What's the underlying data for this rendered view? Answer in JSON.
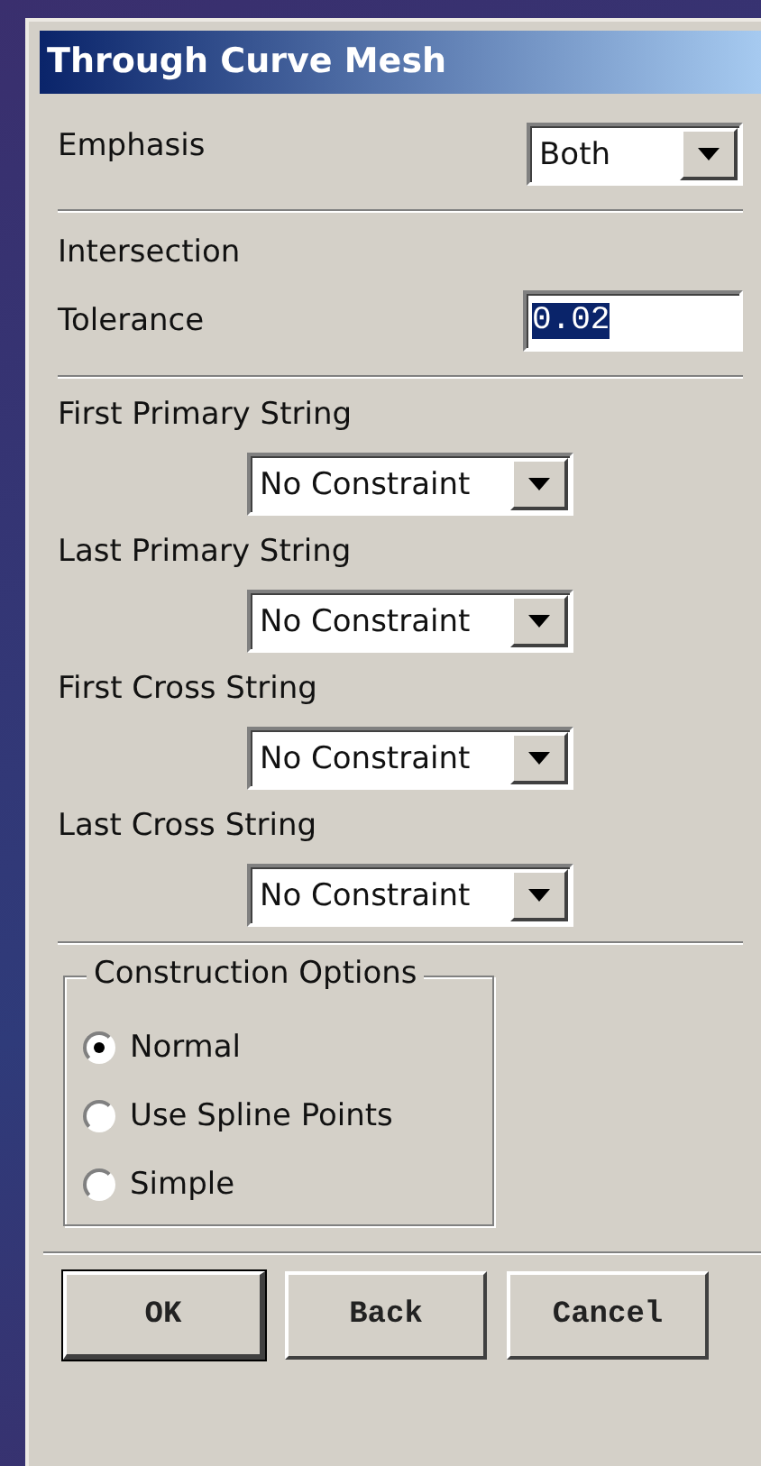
{
  "window": {
    "title": "Through Curve Mesh"
  },
  "emphasis": {
    "label": "Emphasis",
    "value": "Both"
  },
  "intersection": {
    "heading": "Intersection",
    "tolerance_label": "Tolerance",
    "tolerance_value": "0.02",
    "value_selected": true
  },
  "constraints": [
    {
      "label": "First Primary String",
      "value": "No Constraint"
    },
    {
      "label": "Last Primary String",
      "value": "No Constraint"
    },
    {
      "label": "First Cross String",
      "value": "No Constraint"
    },
    {
      "label": "Last Cross String",
      "value": "No Constraint"
    }
  ],
  "construction_options": {
    "title": "Construction Options",
    "options": [
      {
        "label": "Normal",
        "selected": true
      },
      {
        "label": "Use Spline Points",
        "selected": false
      },
      {
        "label": "Simple",
        "selected": false
      }
    ]
  },
  "buttons": [
    {
      "label": "OK",
      "default": true
    },
    {
      "label": "Back",
      "default": false
    },
    {
      "label": "Cancel",
      "default": false
    }
  ]
}
